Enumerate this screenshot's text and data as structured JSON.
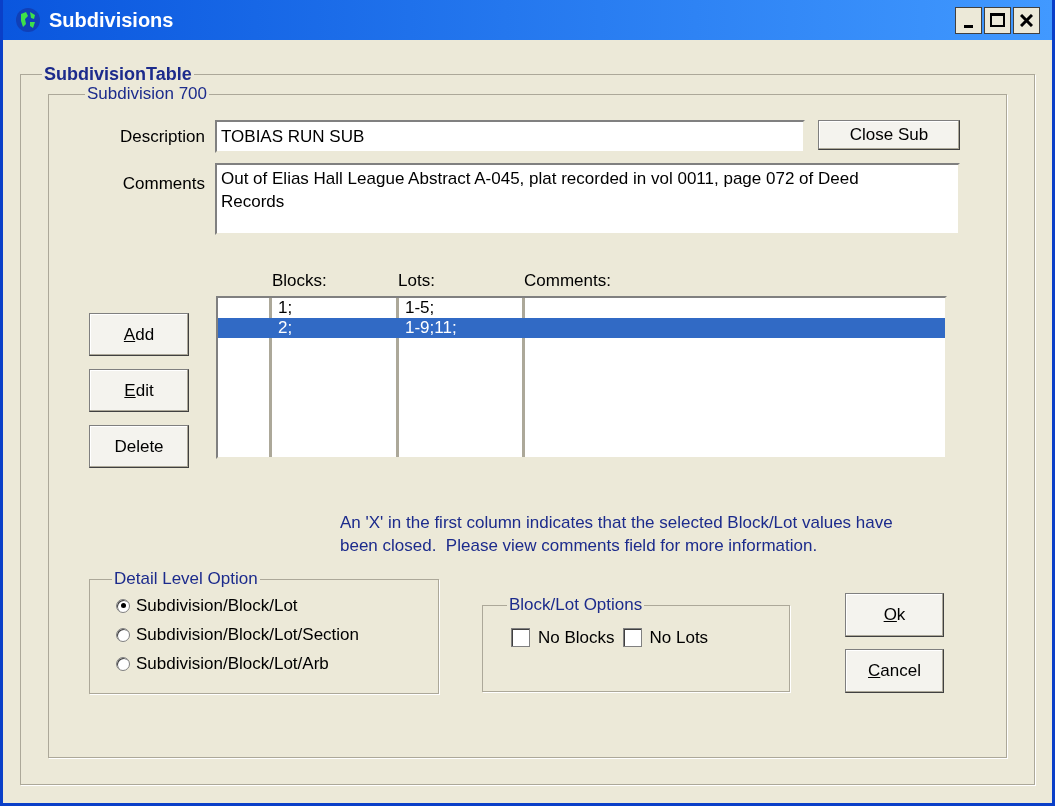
{
  "window": {
    "title": "Subdivisions"
  },
  "group": {
    "title": "SubdivisionTable"
  },
  "subdivision": {
    "title": "Subdivision 700",
    "description_label": "Description",
    "description": "TOBIAS RUN SUB",
    "close_button": "Close Sub",
    "comments_label": "Comments",
    "comments": "Out of Elias Hall League Abstract A-045, plat recorded in vol 0011, page 072 of Deed Records"
  },
  "table": {
    "columns": [
      "Blocks:",
      "Lots:",
      "Comments:"
    ],
    "rows": [
      {
        "blocks": "1;",
        "lots": "1-5;",
        "selected": false
      },
      {
        "blocks": "2;",
        "lots": "1-9;11;",
        "selected": true
      }
    ]
  },
  "actions": [
    {
      "mnemonic": "A",
      "rest": "dd"
    },
    {
      "mnemonic": "E",
      "rest": "dit"
    },
    {
      "rest": "Delete"
    }
  ],
  "note": "An 'X' in the first column indicates that the selected Block/Lot values have been closed.  Please view comments field for more information.",
  "detail_level": {
    "title": "Detail Level Option",
    "options": [
      {
        "label": "Subdivision/Block/Lot",
        "selected": true
      },
      {
        "label": "Subdivision/Block/Lot/Section",
        "selected": false
      },
      {
        "label": "Subdivision/Block/Lot/Arb",
        "selected": false
      }
    ]
  },
  "block_lot_options": {
    "title": "Block/Lot Options",
    "options": [
      {
        "label": "No Blocks",
        "checked": false
      },
      {
        "label": "No Lots",
        "checked": false
      }
    ]
  },
  "dialog_buttons": [
    {
      "mnemonic": "O",
      "rest": "k"
    },
    {
      "mnemonic": "C",
      "rest": "ancel"
    }
  ]
}
